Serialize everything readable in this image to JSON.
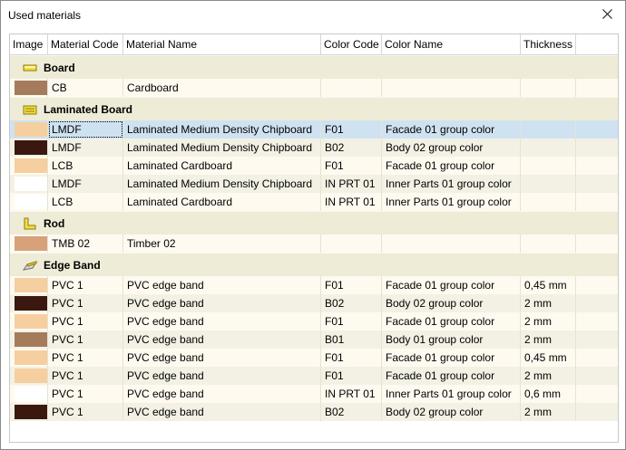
{
  "window": {
    "title": "Used materials"
  },
  "columns": {
    "image": "Image",
    "code": "Material Code",
    "name": "Material Name",
    "color_code": "Color Code",
    "color_name": "Color Name",
    "thickness": "Thickness"
  },
  "groups": [
    {
      "label": "Board",
      "icon": "board-icon",
      "rows": [
        {
          "swatch": "#a47c5c",
          "code": "CB",
          "name": "Cardboard",
          "color_code": "",
          "color_name": "",
          "thickness": ""
        }
      ]
    },
    {
      "label": "Laminated Board",
      "icon": "laminated-board-icon",
      "rows": [
        {
          "swatch": "#f5cfa0",
          "code": "LMDF",
          "name": "Laminated Medium Density Chipboard",
          "color_code": "F01",
          "color_name": "Facade 01 group color",
          "thickness": "",
          "selected": true
        },
        {
          "swatch": "#3a1810",
          "code": "LMDF",
          "name": "Laminated Medium Density Chipboard",
          "color_code": "B02",
          "color_name": "Body 02 group color",
          "thickness": ""
        },
        {
          "swatch": "#f5cfa0",
          "code": "LCB",
          "name": "Laminated Cardboard",
          "color_code": "F01",
          "color_name": "Facade 01 group color",
          "thickness": ""
        },
        {
          "swatch": "#ffffff",
          "code": "LMDF",
          "name": "Laminated Medium Density Chipboard",
          "color_code": "IN PRT 01",
          "color_name": "Inner Parts 01 group color",
          "thickness": ""
        },
        {
          "swatch": "#ffffff",
          "code": "LCB",
          "name": "Laminated Cardboard",
          "color_code": "IN PRT 01",
          "color_name": "Inner Parts 01 group color",
          "thickness": ""
        }
      ]
    },
    {
      "label": "Rod",
      "icon": "rod-icon",
      "rows": [
        {
          "swatch": "#d7a27a",
          "code": "TMB 02",
          "name": "Timber 02",
          "color_code": "",
          "color_name": "",
          "thickness": ""
        }
      ]
    },
    {
      "label": "Edge Band",
      "icon": "edge-band-icon",
      "rows": [
        {
          "swatch": "#f5cfa0",
          "code": "PVC 1",
          "name": "PVC edge band",
          "color_code": "F01",
          "color_name": "Facade 01 group color",
          "thickness": "0,45 mm"
        },
        {
          "swatch": "#3a1810",
          "code": "PVC 1",
          "name": "PVC edge band",
          "color_code": "B02",
          "color_name": "Body 02 group color",
          "thickness": "2 mm"
        },
        {
          "swatch": "#f5cfa0",
          "code": "PVC 1",
          "name": "PVC edge band",
          "color_code": "F01",
          "color_name": "Facade 01 group color",
          "thickness": "2 mm"
        },
        {
          "swatch": "#a47c5c",
          "code": "PVC 1",
          "name": "PVC edge band",
          "color_code": "B01",
          "color_name": "Body 01 group color",
          "thickness": "2 mm"
        },
        {
          "swatch": "#f5cfa0",
          "code": "PVC 1",
          "name": "PVC edge band",
          "color_code": "F01",
          "color_name": "Facade 01 group color",
          "thickness": "0,45 mm"
        },
        {
          "swatch": "#f5cfa0",
          "code": "PVC 1",
          "name": "PVC edge band",
          "color_code": "F01",
          "color_name": "Facade 01 group color",
          "thickness": "2 mm"
        },
        {
          "swatch": "#ffffff",
          "code": "PVC 1",
          "name": "PVC edge band",
          "color_code": "IN PRT 01",
          "color_name": "Inner Parts 01 group color",
          "thickness": "0,6 mm"
        },
        {
          "swatch": "#3a1810",
          "code": "PVC 1",
          "name": "PVC edge band",
          "color_code": "B02",
          "color_name": "Body 02 group color",
          "thickness": "2 mm"
        }
      ]
    }
  ]
}
